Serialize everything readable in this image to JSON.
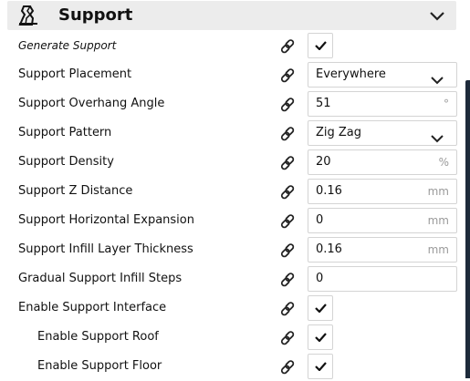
{
  "header": {
    "title": "Support",
    "icon": "support-category-icon",
    "collapse_icon": "chevron-down-icon"
  },
  "settings": [
    {
      "label": "Generate Support",
      "control": "checkbox",
      "checked": true,
      "italic": true
    },
    {
      "label": "Support Placement",
      "control": "dropdown",
      "value": "Everywhere"
    },
    {
      "label": "Support Overhang Angle",
      "control": "input",
      "value": "51",
      "unit": "°"
    },
    {
      "label": "Support Pattern",
      "control": "dropdown",
      "value": "Zig Zag"
    },
    {
      "label": "Support Density",
      "control": "input",
      "value": "20",
      "unit": "%"
    },
    {
      "label": "Support Z Distance",
      "control": "input",
      "value": "0.16",
      "unit": "mm"
    },
    {
      "label": "Support Horizontal Expansion",
      "control": "input",
      "value": "0",
      "unit": "mm"
    },
    {
      "label": "Support Infill Layer Thickness",
      "control": "input",
      "value": "0.16",
      "unit": "mm"
    },
    {
      "label": "Gradual Support Infill Steps",
      "control": "input",
      "value": "0",
      "unit": ""
    },
    {
      "label": "Enable Support Interface",
      "control": "checkbox",
      "checked": true
    },
    {
      "label": "Enable Support Roof",
      "control": "checkbox",
      "checked": true,
      "indent": true
    },
    {
      "label": "Enable Support Floor",
      "control": "checkbox",
      "checked": true,
      "indent": true
    }
  ],
  "colors": {
    "header_bg": "#ececec",
    "border": "#d4d4d4",
    "unit_text": "#9a9a9a",
    "scrollbar": "#1d2a3a"
  },
  "icons": {
    "link": "link-icon",
    "check": "checkmark-icon",
    "dropdown": "chevron-down-icon"
  }
}
